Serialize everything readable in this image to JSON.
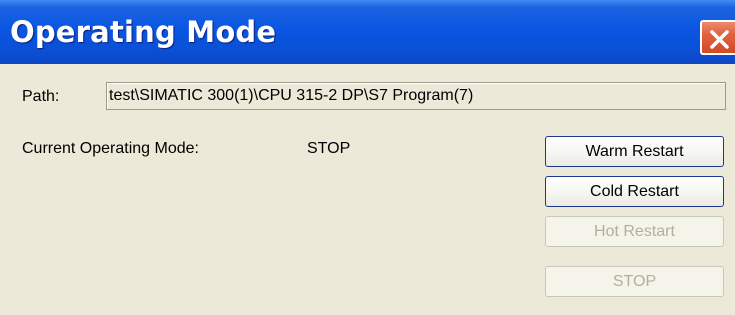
{
  "window": {
    "title": "Operating Mode",
    "close_icon": "close-icon"
  },
  "path": {
    "label": "Path:",
    "value": "test\\SIMATIC 300(1)\\CPU 315-2 DP\\S7 Program(7)"
  },
  "mode": {
    "label": "Current Operating Mode:",
    "value": "STOP"
  },
  "buttons": [
    {
      "label": "Warm Restart",
      "enabled": true
    },
    {
      "label": "Cold Restart",
      "enabled": true
    },
    {
      "label": "Hot Restart",
      "enabled": false
    },
    {
      "label": "STOP",
      "enabled": false
    }
  ],
  "colors": {
    "titlebar": "#0a56e3",
    "close_button": "#d24b27",
    "dialog_background": "#ece9d8",
    "disabled_text": "#b2aea0"
  }
}
